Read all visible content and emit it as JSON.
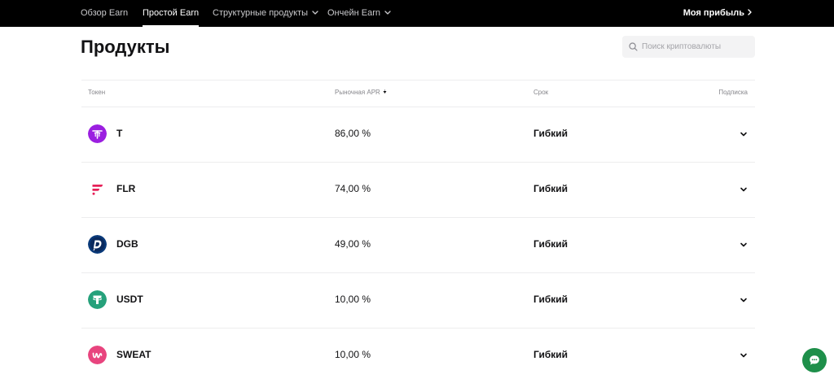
{
  "nav": {
    "items": [
      {
        "label": "Обзор Earn",
        "active": false,
        "dropdown": false
      },
      {
        "label": "Простой Earn",
        "active": true,
        "dropdown": false
      },
      {
        "label": "Структурные продукты",
        "active": false,
        "dropdown": true
      },
      {
        "label": "Ончейн Earn",
        "active": false,
        "dropdown": true
      }
    ],
    "profit_label": "Моя прибыль"
  },
  "page": {
    "title": "Продукты"
  },
  "search": {
    "placeholder": "Поиск криптовалюты",
    "value": ""
  },
  "table": {
    "headers": {
      "token": "Токен",
      "apr": "Рыночная APR",
      "term": "Срок",
      "subscribe": "Подписка"
    },
    "rows": [
      {
        "token": "T",
        "apr": "86,00 %",
        "term": "Гибкий",
        "icon": "t-coin-icon",
        "icon_color": "#9b1fe0"
      },
      {
        "token": "FLR",
        "apr": "74,00 %",
        "term": "Гибкий",
        "icon": "flr-coin-icon",
        "icon_color": "#e62058"
      },
      {
        "token": "DGB",
        "apr": "49,00 %",
        "term": "Гибкий",
        "icon": "dgb-coin-icon",
        "icon_color": "#0a3a7a"
      },
      {
        "token": "USDT",
        "apr": "10,00 %",
        "term": "Гибкий",
        "icon": "usdt-coin-icon",
        "icon_color": "#26a17b"
      },
      {
        "token": "SWEAT",
        "apr": "10,00 %",
        "term": "Гибкий",
        "icon": "sweat-coin-icon",
        "icon_color": "#e8447e"
      }
    ]
  },
  "colors": {
    "nav_bg": "#000000",
    "chat_fab": "#1e8f4a",
    "divider": "#ededee",
    "header_text": "#86868b"
  }
}
